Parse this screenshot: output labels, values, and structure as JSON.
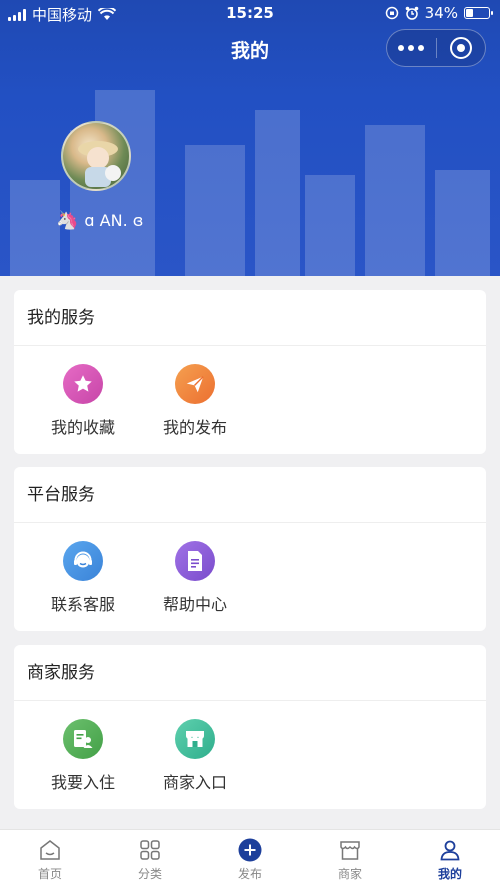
{
  "status_bar": {
    "carrier": "中国移动",
    "time": "15:25",
    "battery": "34%",
    "battery_level": 0.34
  },
  "nav": {
    "title": "我的"
  },
  "profile": {
    "username": "ɑ AN. ɞ",
    "badge": "🦄"
  },
  "colors": {
    "brand": "#2250c3",
    "tab_active": "#1d3f9b",
    "favorites_icon": "#d956b4",
    "publish_icon": "#f07f3c",
    "support_icon": "#3f8fe0",
    "help_icon": "#8a5bd9",
    "join_icon": "#4caf50",
    "merchant_icon": "#3bbf9a"
  },
  "sections": [
    {
      "title": "我的服务",
      "items": [
        {
          "label": "我的收藏",
          "icon": "star-icon"
        },
        {
          "label": "我的发布",
          "icon": "send-icon"
        }
      ]
    },
    {
      "title": "平台服务",
      "items": [
        {
          "label": "联系客服",
          "icon": "headset-icon"
        },
        {
          "label": "帮助中心",
          "icon": "document-icon"
        }
      ]
    },
    {
      "title": "商家服务",
      "items": [
        {
          "label": "我要入住",
          "icon": "registration-icon"
        },
        {
          "label": "商家入口",
          "icon": "storefront-icon"
        }
      ]
    }
  ],
  "tabbar": {
    "items": [
      {
        "label": "首页",
        "icon": "home-icon",
        "active": false
      },
      {
        "label": "分类",
        "icon": "grid-icon",
        "active": false
      },
      {
        "label": "发布",
        "icon": "plus-circle-icon",
        "active": false
      },
      {
        "label": "商家",
        "icon": "shop-icon",
        "active": false
      },
      {
        "label": "我的",
        "icon": "user-icon",
        "active": true
      }
    ]
  }
}
